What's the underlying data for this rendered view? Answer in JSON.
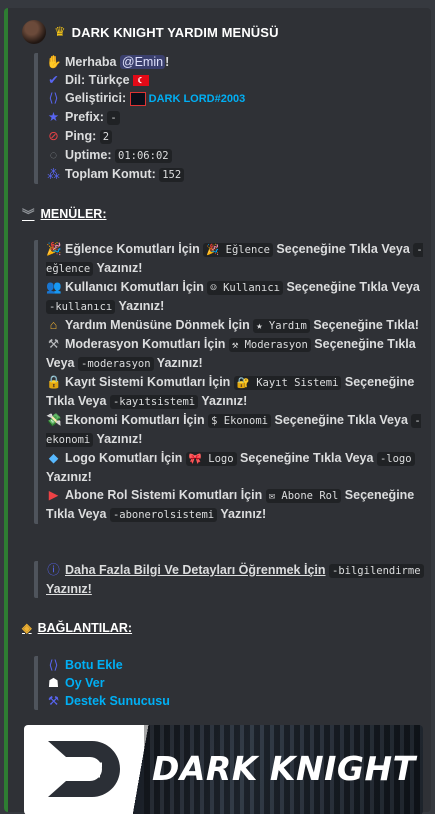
{
  "author": {
    "title": "DARK KNIGHT YARDIM MENÜSÜ"
  },
  "info": {
    "greeting_prefix": "Merhaba",
    "greeting_mention": "@Emin",
    "greeting_suffix": "!",
    "lang_label": "Dil: Türkçe",
    "dev_label": "Geliştirici:",
    "dev_name": "DARK LORD#2003",
    "prefix_label": "Prefix:",
    "prefix_value": "-",
    "ping_label": "Ping:",
    "ping_value": "2",
    "uptime_label": "Uptime:",
    "uptime_value": "01:06:02",
    "commands_label": "Toplam Komut:",
    "commands_value": "152"
  },
  "menus": {
    "title": "MENÜLER:",
    "items": [
      {
        "pre": "Eğlence Komutları İçin",
        "chip": "Eğlence",
        "mid": "Seçeneğine Tıkla Veya",
        "code": "-eğlence",
        "post": "Yazınız!"
      },
      {
        "pre": "Kullanıcı Komutları İçin",
        "chip": "Kullanıcı",
        "mid": "Seçeneğine Tıkla Veya",
        "code": "-kullanıcı",
        "post": "Yazınız!"
      },
      {
        "pre": "Yardım Menüsüne Dönmek İçin",
        "chip": "Yardım",
        "mid": "Seçeneğine Tıkla!",
        "code": "",
        "post": ""
      },
      {
        "pre": "Moderasyon Komutları İçin",
        "chip": "Moderasyon",
        "mid": "Seçeneğine Tıkla Veya",
        "code": "-moderasyon",
        "post": "Yazınız!"
      },
      {
        "pre": "Kayıt Sistemi Komutları İçin",
        "chip": "Kayıt Sistemi",
        "mid": "Seçeneğine Tıkla Veya",
        "code": "-kayıtsistemi",
        "post": "Yazınız!"
      },
      {
        "pre": "Ekonomi Komutları İçin",
        "chip": "Ekonomi",
        "mid": "Seçeneğine Tıkla Veya",
        "code": "-ekonomi",
        "post": "Yazınız!"
      },
      {
        "pre": "Logo Komutları İçin",
        "chip": "Logo",
        "mid": "Seçeneğine Tıkla Veya",
        "code": "-logo",
        "post": "Yazınız!"
      },
      {
        "pre": "Abone Rol Sistemi Komutları İçin",
        "chip": "Abone Rol",
        "mid": "Seçeneğine Tıkla Veya",
        "code": "-abonerolsistemi",
        "post": "Yazınız!"
      }
    ]
  },
  "more_info": {
    "text": "Daha Fazla Bilgi Ve Detayları Öğrenmek İçin",
    "code": "-bilgilendirme",
    "post": "Yazınız!"
  },
  "links": {
    "title": "BAĞLANTILAR:",
    "add_bot": "Botu Ekle",
    "vote": "Oy Ver",
    "support": "Destek Sunucusu"
  },
  "banner": {
    "text": "DARK KNIGHT"
  }
}
